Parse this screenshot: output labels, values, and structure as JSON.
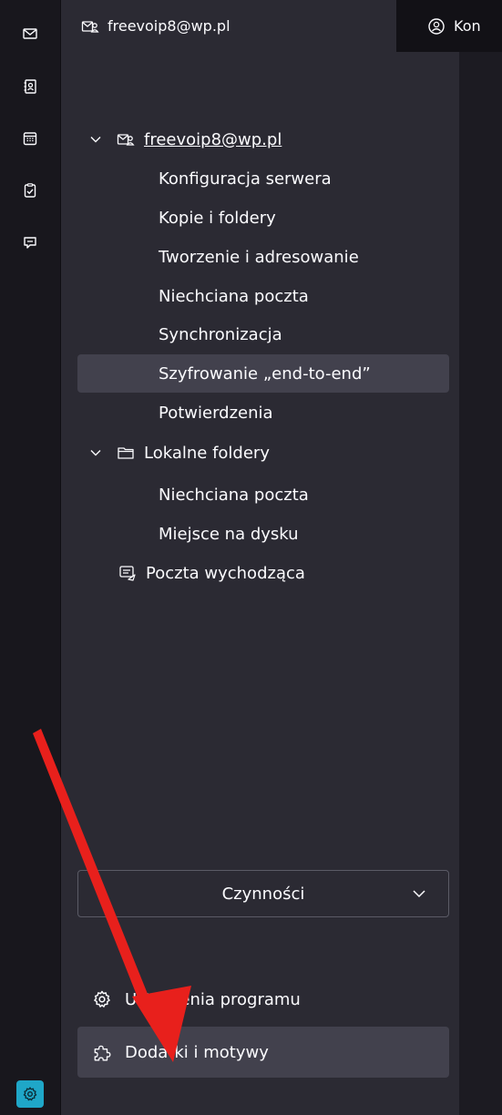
{
  "spaces_toolbar": {
    "items": [
      {
        "icon": "mail-icon"
      },
      {
        "icon": "address-book-icon"
      },
      {
        "icon": "calendar-icon"
      },
      {
        "icon": "tasks-icon"
      },
      {
        "icon": "chat-icon"
      }
    ],
    "settings_icon": "gear-icon"
  },
  "tabs": [
    {
      "label": "freevoip8@wp.pl",
      "icon": "account-icon",
      "active": true
    },
    {
      "label": "Kon",
      "icon": "address-book-tab-icon",
      "active": false
    }
  ],
  "account_tree": {
    "account": {
      "label": "freevoip8@wp.pl",
      "items": [
        {
          "label": "Konfiguracja serwera"
        },
        {
          "label": "Kopie i foldery"
        },
        {
          "label": "Tworzenie i adresowanie"
        },
        {
          "label": "Niechciana poczta"
        },
        {
          "label": "Synchronizacja"
        },
        {
          "label": "Szyfrowanie „end-to-end”",
          "selected": true
        },
        {
          "label": "Potwierdzenia"
        }
      ]
    },
    "local_folders": {
      "label": "Lokalne foldery",
      "items": [
        {
          "label": "Niechciana poczta"
        },
        {
          "label": "Miejsce na dysku"
        }
      ]
    },
    "outgoing": {
      "label": "Poczta wychodząca"
    }
  },
  "actions_dropdown": {
    "label": "Czynności"
  },
  "bottom_buttons": {
    "settings_label": "Ustawienia programu",
    "addons_label": "Dodatki i motywy"
  },
  "colors": {
    "panel_bg": "#2b2a33",
    "selected_row": "#42414d",
    "accent": "#1fa7c8",
    "annotation_arrow": "#e8201c"
  }
}
